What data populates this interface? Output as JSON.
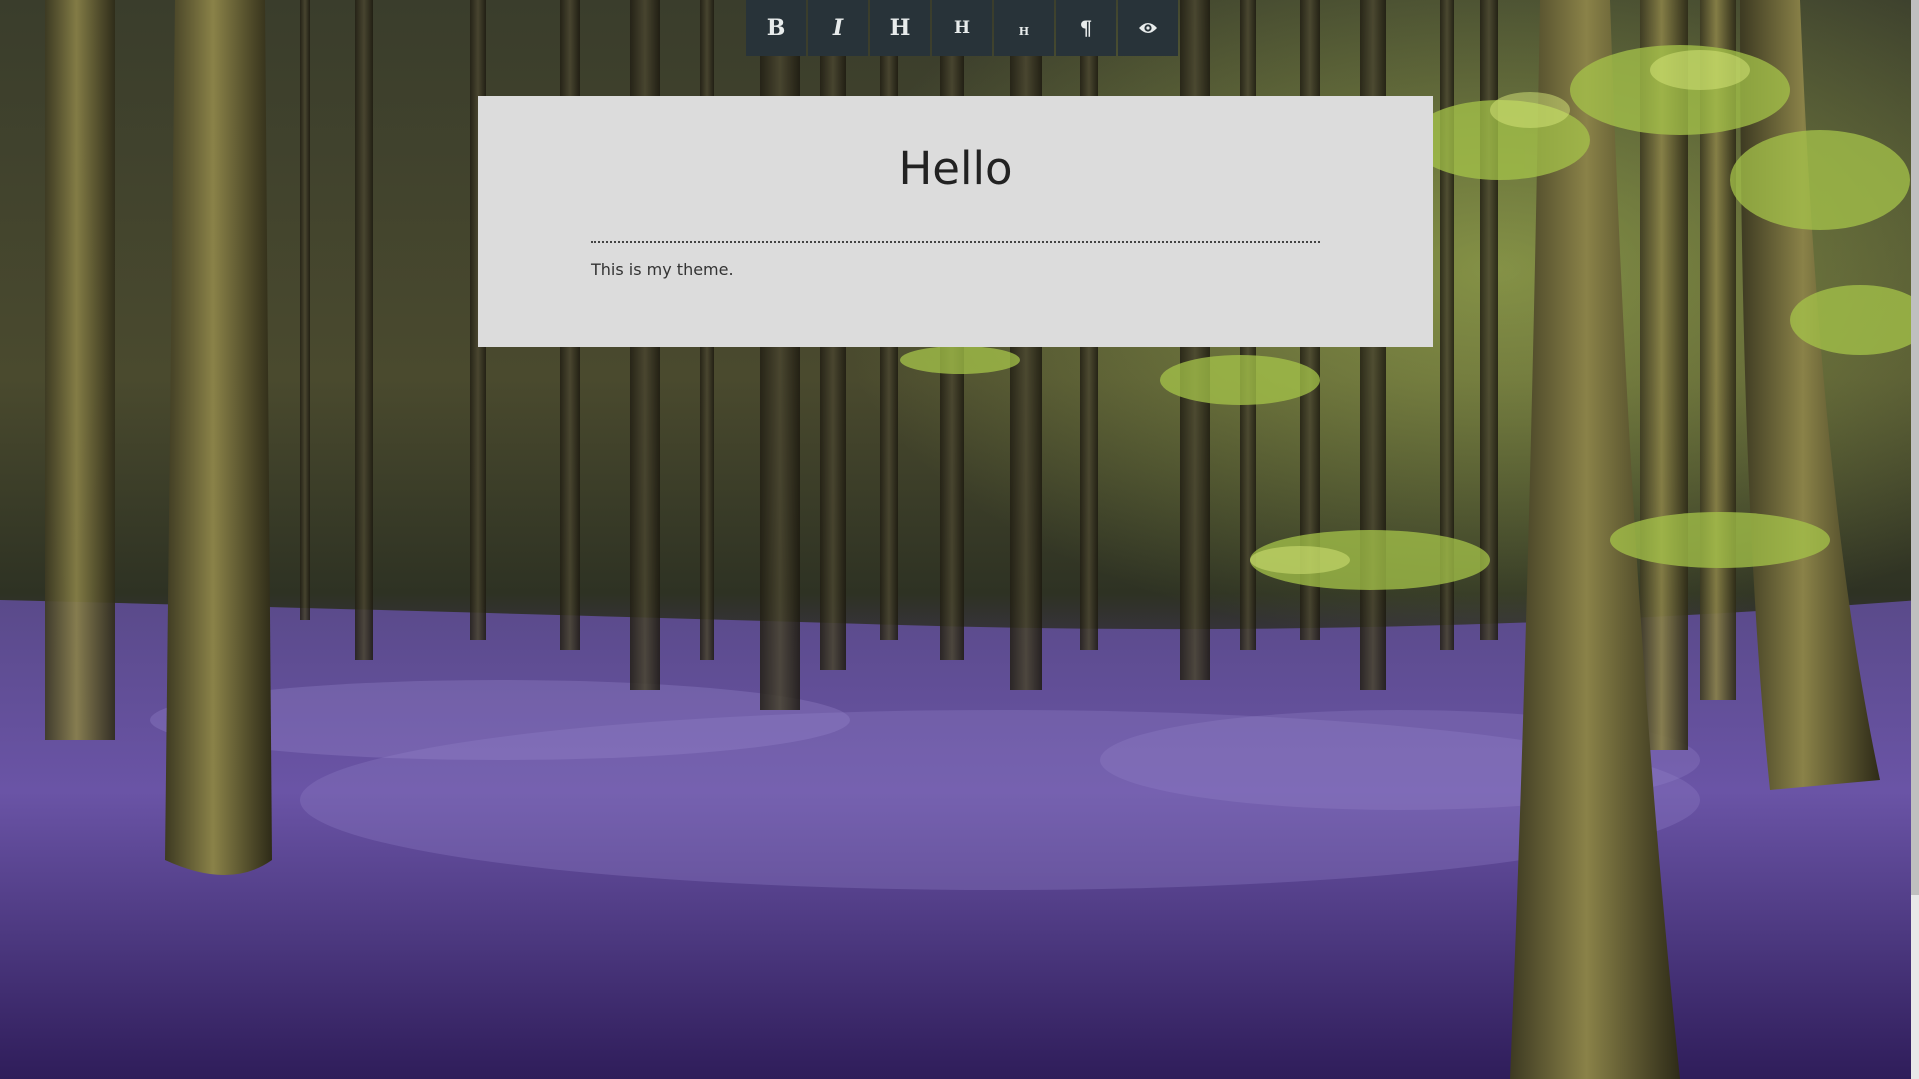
{
  "toolbar": {
    "buttons": [
      {
        "name": "bold-button",
        "label": "B"
      },
      {
        "name": "italic-button",
        "label": "I"
      },
      {
        "name": "heading1-button",
        "label": "H"
      },
      {
        "name": "heading2-button",
        "label": "H"
      },
      {
        "name": "heading3-button",
        "label": "H"
      },
      {
        "name": "paragraph-button",
        "label": "¶"
      },
      {
        "name": "preview-button",
        "icon": "eye-icon"
      }
    ]
  },
  "document": {
    "title": "Hello",
    "body": "This is my theme."
  },
  "colors": {
    "toolbar_bg": "#283339",
    "card_bg": "#dcdcdc",
    "bluebell": "#5b3f91"
  }
}
